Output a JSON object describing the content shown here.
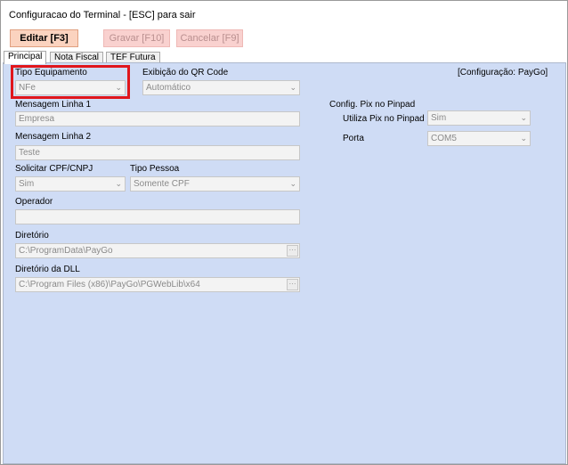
{
  "window": {
    "title": "Configuracao do Terminal - [ESC] para sair"
  },
  "toolbar": {
    "editar": "Editar [F3]",
    "gravar": "Gravar [F10]",
    "cancelar": "Cancelar [F9]"
  },
  "tabs": [
    {
      "label": "Principal"
    },
    {
      "label": "Nota Fiscal"
    },
    {
      "label": "TEF Futura"
    }
  ],
  "form": {
    "tipo_equipamento": {
      "label": "Tipo Equipamento",
      "value": "NFe"
    },
    "exibicao_qr": {
      "label": "Exibição do QR Code",
      "value": "Automático"
    },
    "config_label": "[Configuração: PayGo]",
    "mensagem1": {
      "label": "Mensagem Linha 1",
      "value": "Empresa"
    },
    "mensagem2": {
      "label": "Mensagem Linha 2",
      "value": "Teste"
    },
    "solicitar_cpf": {
      "label": "Solicitar CPF/CNPJ",
      "value": "Sim"
    },
    "tipo_pessoa": {
      "label": "Tipo Pessoa",
      "value": "Somente CPF"
    },
    "operador": {
      "label": "Operador",
      "value": ""
    },
    "diretorio": {
      "label": "Diretório",
      "value": "C:\\ProgramData\\PayGo"
    },
    "diretorio_dll": {
      "label": "Diretório da DLL",
      "value": "C:\\Program Files (x86)\\PayGo\\PGWebLib\\x64"
    },
    "pix": {
      "section_label": "Config. Pix no Pinpad",
      "utiliza_label": "Utiliza Pix no Pinpad",
      "utiliza_value": "Sim",
      "porta_label": "Porta",
      "porta_value": "COM5"
    }
  },
  "icons": {
    "dropdown": "chevron-down-icon",
    "browse": "ellipsis-button"
  },
  "colors": {
    "panel_bg": "#cfdcf5",
    "highlight": "#e0161c",
    "active_button": "#fbd3bf"
  }
}
